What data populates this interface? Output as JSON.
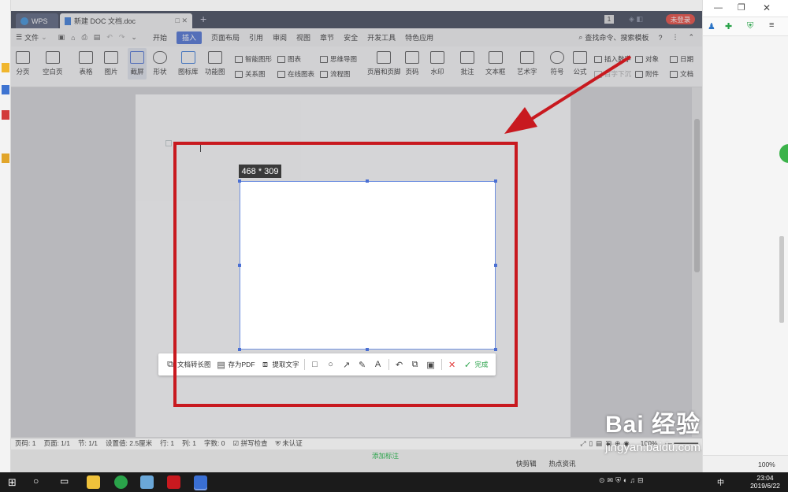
{
  "tabs": {
    "wps": "WPS",
    "doc": "新建 DOC 文档.doc",
    "new_tab": "+"
  },
  "title_right": {
    "badge": "1",
    "login": "未登录"
  },
  "menu": {
    "file": "文件",
    "items": [
      "开始",
      "插入",
      "页面布局",
      "引用",
      "审阅",
      "视图",
      "章节",
      "安全",
      "开发工具",
      "特色应用"
    ],
    "active": "插入",
    "search": "查找命令、搜索模板",
    "help": "?"
  },
  "ribbon": {
    "big": [
      "分页",
      "空白页",
      "表格",
      "图片",
      "截屏",
      "形状",
      "图标库",
      "功能图"
    ],
    "small_a": [
      "智能图形",
      "关系图"
    ],
    "small_b": [
      "图表",
      "在线图表"
    ],
    "small_c": [
      "思维导图",
      "流程图"
    ],
    "big2": [
      "页眉和页脚",
      "页码",
      "水印",
      "批注",
      "文本框",
      "艺术字",
      "符号",
      "公式"
    ],
    "small_d": [
      "插入数字",
      "首字下沉"
    ],
    "small_e": [
      "对象",
      "附件"
    ],
    "small_f": [
      "日期",
      "文档"
    ]
  },
  "capture": {
    "size_label": "468 * 309",
    "toolbar": {
      "long_image": "文档转长图",
      "save_pdf": "存为PDF",
      "extract_text": "提取文字",
      "done": "完成"
    }
  },
  "status": {
    "page_no": "页码: 1",
    "pages": "页面: 1/1",
    "section": "节: 1/1",
    "setting": "设置值: 2.5厘米",
    "row": "行: 1",
    "col": "列: 1",
    "words": "字数: 0",
    "spell": "拼写检查",
    "cert": "未认证",
    "zoom": "100%"
  },
  "browser_bottom": {
    "clip": "快剪辑",
    "news": "热点资讯",
    "add": "添加标注"
  },
  "taskbar": {
    "time": "23:04",
    "date": "2019/6/22",
    "ime": "中",
    "zoom": "100%"
  },
  "watermark": {
    "brand": "Bai 经验",
    "url": "jingyan.baidu.com"
  },
  "colors": {
    "accent": "#4a6fd3",
    "annotation_red": "#c8191f",
    "login_red": "#e9463b"
  }
}
